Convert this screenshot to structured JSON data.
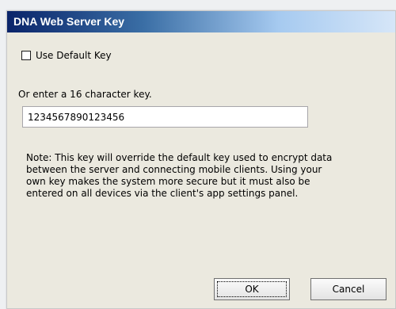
{
  "window": {
    "title": "DNA Web Server Key"
  },
  "checkbox": {
    "label": "Use Default Key",
    "checked": false
  },
  "key": {
    "label": "Or enter a 16 character key.",
    "value": "1234567890123456"
  },
  "note": "Note: This key will override the default key used to encrypt data\nbetween the server and connecting mobile clients. Using your\nown key makes the system more secure but it must also be\nentered on all devices via the client's app settings panel.",
  "buttons": {
    "ok": "OK",
    "cancel": "Cancel"
  }
}
